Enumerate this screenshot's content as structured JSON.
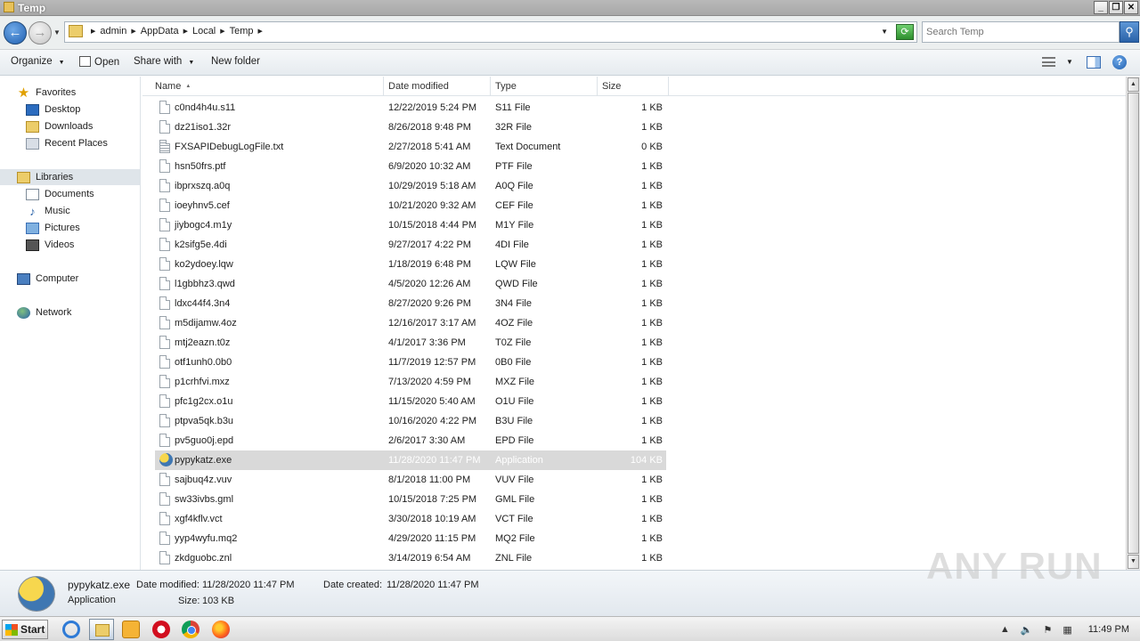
{
  "window": {
    "title": "Temp",
    "buttons": {
      "minimize": "_",
      "maximize": "❐",
      "close": "✕"
    }
  },
  "address": {
    "crumbs": [
      "admin",
      "AppData",
      "Local",
      "Temp"
    ],
    "search_placeholder": "Search Temp"
  },
  "toolbar": {
    "organize": "Organize",
    "open": "Open",
    "share_with": "Share with",
    "new_folder": "New folder"
  },
  "nav": {
    "favorites": "Favorites",
    "desktop": "Desktop",
    "downloads": "Downloads",
    "recent_places": "Recent Places",
    "libraries": "Libraries",
    "documents": "Documents",
    "music": "Music",
    "pictures": "Pictures",
    "videos": "Videos",
    "computer": "Computer",
    "network": "Network"
  },
  "columns": {
    "name": "Name",
    "date": "Date modified",
    "type": "Type",
    "size": "Size"
  },
  "files": [
    {
      "name": "c0nd4h4u.s11",
      "date": "12/22/2019 5:24 PM",
      "type": "S11 File",
      "size": "1 KB"
    },
    {
      "name": "dz21iso1.32r",
      "date": "8/26/2018 9:48 PM",
      "type": "32R File",
      "size": "1 KB"
    },
    {
      "name": "FXSAPIDebugLogFile.txt",
      "date": "2/27/2018 5:41 AM",
      "type": "Text Document",
      "size": "0 KB",
      "icon": "txt"
    },
    {
      "name": "hsn50frs.ptf",
      "date": "6/9/2020 10:32 AM",
      "type": "PTF File",
      "size": "1 KB"
    },
    {
      "name": "ibprxszq.a0q",
      "date": "10/29/2019 5:18 AM",
      "type": "A0Q File",
      "size": "1 KB"
    },
    {
      "name": "ioeyhnv5.cef",
      "date": "10/21/2020 9:32 AM",
      "type": "CEF File",
      "size": "1 KB"
    },
    {
      "name": "jiybogc4.m1y",
      "date": "10/15/2018 4:44 PM",
      "type": "M1Y File",
      "size": "1 KB"
    },
    {
      "name": "k2sifg5e.4di",
      "date": "9/27/2017 4:22 PM",
      "type": "4DI File",
      "size": "1 KB"
    },
    {
      "name": "ko2ydoey.lqw",
      "date": "1/18/2019 6:48 PM",
      "type": "LQW File",
      "size": "1 KB"
    },
    {
      "name": "l1gbbhz3.qwd",
      "date": "4/5/2020 12:26 AM",
      "type": "QWD File",
      "size": "1 KB"
    },
    {
      "name": "ldxc44f4.3n4",
      "date": "8/27/2020 9:26 PM",
      "type": "3N4 File",
      "size": "1 KB"
    },
    {
      "name": "m5dijamw.4oz",
      "date": "12/16/2017 3:17 AM",
      "type": "4OZ File",
      "size": "1 KB"
    },
    {
      "name": "mtj2eazn.t0z",
      "date": "4/1/2017 3:36 PM",
      "type": "T0Z File",
      "size": "1 KB"
    },
    {
      "name": "otf1unh0.0b0",
      "date": "11/7/2019 12:57 PM",
      "type": "0B0 File",
      "size": "1 KB"
    },
    {
      "name": "p1crhfvi.mxz",
      "date": "7/13/2020 4:59 PM",
      "type": "MXZ File",
      "size": "1 KB"
    },
    {
      "name": "pfc1g2cx.o1u",
      "date": "11/15/2020 5:40 AM",
      "type": "O1U File",
      "size": "1 KB"
    },
    {
      "name": "ptpva5qk.b3u",
      "date": "10/16/2020 4:22 PM",
      "type": "B3U File",
      "size": "1 KB"
    },
    {
      "name": "pv5guo0j.epd",
      "date": "2/6/2017 3:30 AM",
      "type": "EPD File",
      "size": "1 KB"
    },
    {
      "name": "pypykatz.exe",
      "date": "11/28/2020 11:47 PM",
      "type": "Application",
      "size": "104 KB",
      "icon": "exe",
      "selected": true
    },
    {
      "name": "sajbuq4z.vuv",
      "date": "8/1/2018 11:00 PM",
      "type": "VUV File",
      "size": "1 KB"
    },
    {
      "name": "sw33ivbs.gml",
      "date": "10/15/2018 7:25 PM",
      "type": "GML File",
      "size": "1 KB"
    },
    {
      "name": "xgf4kflv.vct",
      "date": "3/30/2018 10:19 AM",
      "type": "VCT File",
      "size": "1 KB"
    },
    {
      "name": "yyp4wyfu.mq2",
      "date": "4/29/2020 11:15 PM",
      "type": "MQ2 File",
      "size": "1 KB"
    },
    {
      "name": "zkdguobc.znl",
      "date": "3/14/2019 6:54 AM",
      "type": "ZNL File",
      "size": "1 KB"
    }
  ],
  "details": {
    "filename": "pypykatz.exe",
    "type": "Application",
    "modified_label": "Date modified:",
    "modified_value": "11/28/2020 11:47 PM",
    "size_label": "Size:",
    "size_value": "103 KB",
    "created_label": "Date created:",
    "created_value": "11/28/2020 11:47 PM"
  },
  "watermark": "ANY RUN",
  "taskbar": {
    "start": "Start",
    "clock": "11:49 PM"
  },
  "colors": {
    "selected_row": "#d9d9d9",
    "accent_blue": "#2a62a8"
  }
}
